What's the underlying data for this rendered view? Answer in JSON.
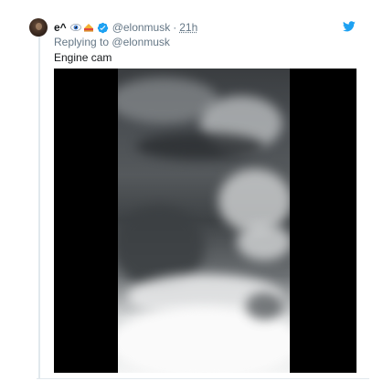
{
  "tweet": {
    "display_name": "e^",
    "handle": "@elonmusk",
    "separator": "·",
    "time": "21h",
    "reply_prefix": "Replying to",
    "reply_to": "@elonmusk",
    "text": "Engine cam"
  },
  "icons": {
    "avatar": "avatar-photo",
    "emoji_1": "eye-emoji",
    "emoji_2": "sandwich-emoji",
    "verified": "verified-badge-icon",
    "logo": "twitter-bird-icon"
  },
  "colors": {
    "brand": "#1da1f2",
    "muted_text": "#657786",
    "primary_text": "#14171a",
    "border": "#e1e8ed",
    "video_letterbox": "#000000"
  }
}
